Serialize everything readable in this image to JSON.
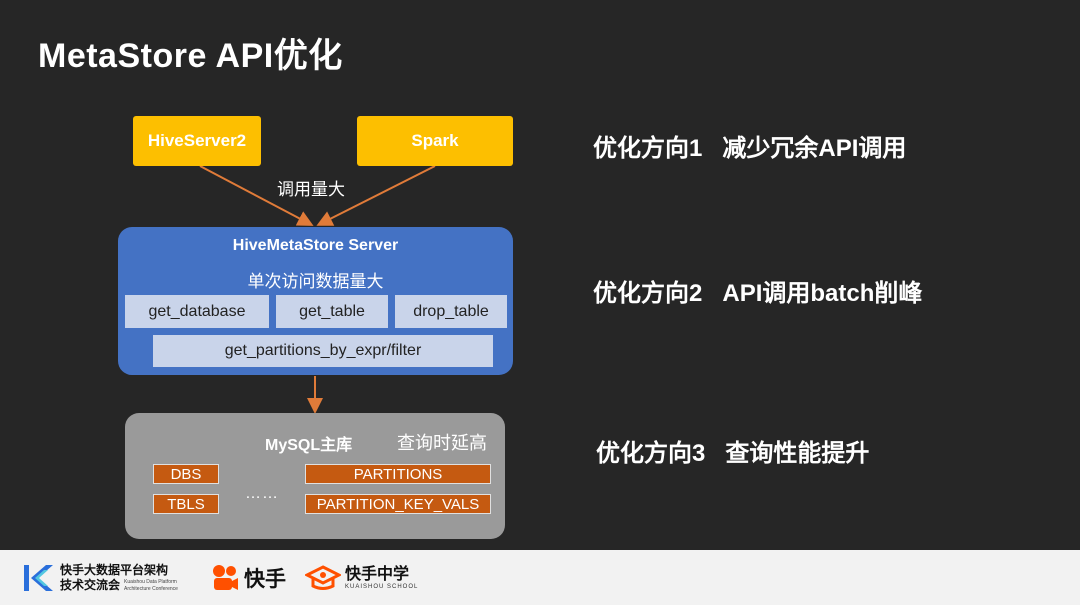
{
  "slide": {
    "title": "MetaStore API优化"
  },
  "clients": {
    "hiveserver2": "HiveServer2",
    "spark": "Spark",
    "arrow_label": "调用量大"
  },
  "server": {
    "name": "HiveMetaStore Server",
    "subtitle": "单次访问数据量大",
    "apis": [
      "get_database",
      "get_table",
      "drop_table",
      "get_partitions_by_expr/filter"
    ]
  },
  "mysql": {
    "name": "MySQL主库",
    "latency_label": "查询时延高",
    "tables_left": [
      "DBS",
      "TBLS"
    ],
    "ellipsis": "……",
    "tables_right": [
      "PARTITIONS",
      "PARTITION_KEY_VALS"
    ]
  },
  "directions": [
    {
      "label": "优化方向1",
      "text": "减少冗余API调用"
    },
    {
      "label": "优化方向2",
      "text": "API调用batch削峰"
    },
    {
      "label": "优化方向3",
      "text": "查询性能提升"
    }
  ],
  "footer": {
    "forum_line1": "快手大数据平台架构",
    "forum_line2": "技术交流会",
    "forum_sub1": "Kuaishou Data Platform",
    "forum_sub2": "Architecture Conference",
    "kuaishou_brand": "快手",
    "school_name": "快手中学",
    "school_sub": "KUAISHOU SCHOOL"
  },
  "colors": {
    "background": "#262626",
    "client_box": "#fdbf00",
    "server_box": "#4472c4",
    "api_box": "#c9d4ea",
    "mysql_box": "#9a9a9a",
    "table_box": "#c55a11",
    "arrow": "#e07b39",
    "footer": "#f2f2f2"
  }
}
